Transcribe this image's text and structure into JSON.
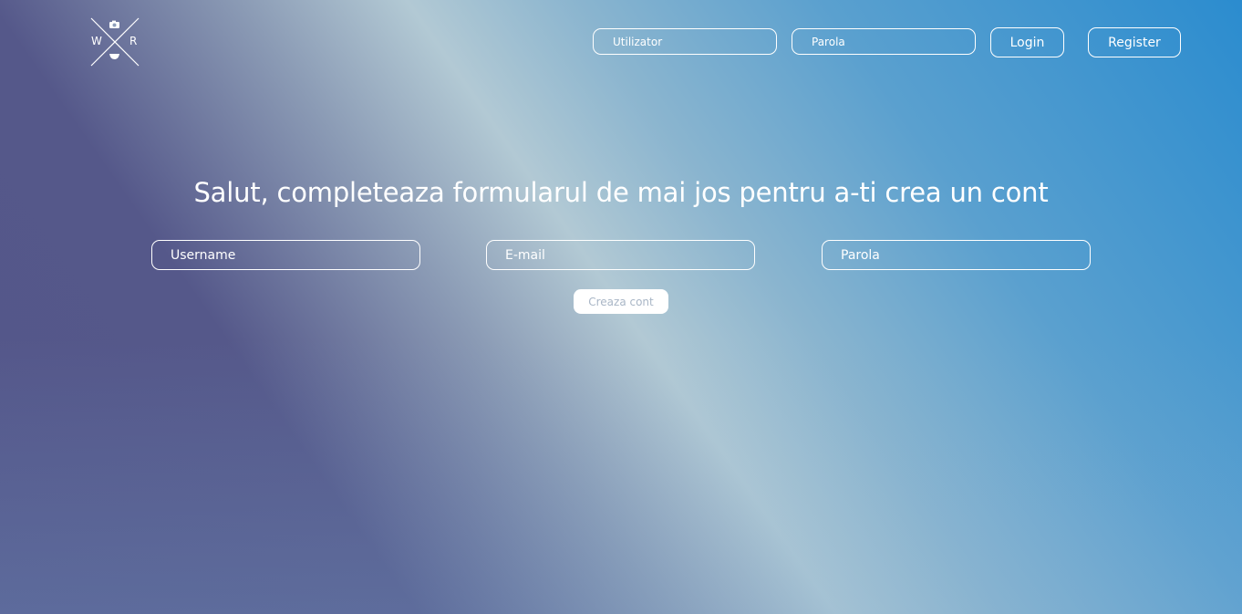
{
  "logo": {
    "left_letter": "W",
    "right_letter": "R",
    "icons": [
      "camera-icon",
      "cup-icon"
    ]
  },
  "header": {
    "username_placeholder": "Utilizator",
    "password_placeholder": "Parola",
    "login_label": "Login",
    "register_label": "Register"
  },
  "main": {
    "title": "Salut, completeaza formularul de mai jos pentru a-ti crea un cont",
    "username_placeholder": "Username",
    "email_placeholder": "E-mail",
    "password_placeholder": "Parola",
    "submit_label": "Creaza cont"
  },
  "colors": {
    "gradient_dark": "#55588a",
    "gradient_light": "#b2c9d4",
    "gradient_blue": "#2b8ccf",
    "text": "#ffffff",
    "submit_text": "#a9b6c6"
  }
}
